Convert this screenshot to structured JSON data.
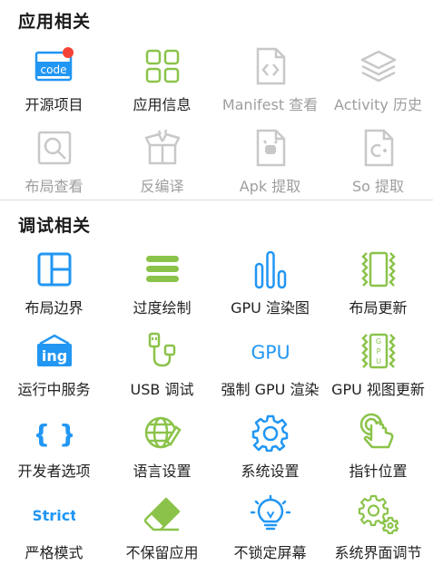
{
  "sections": {
    "app_related": {
      "title": "应用相关"
    },
    "debug_related": {
      "title": "调试相关"
    }
  },
  "app_items": [
    {
      "label": "开源项目",
      "icon": "code-icon",
      "enabled": true,
      "badge_text": "code"
    },
    {
      "label": "应用信息",
      "icon": "grid-apps-icon",
      "enabled": true
    },
    {
      "label": "Manifest 查看",
      "icon": "manifest-file-icon",
      "enabled": false
    },
    {
      "label": "Activity 历史",
      "icon": "layers-icon",
      "enabled": false
    },
    {
      "label": "布局查看",
      "icon": "layout-search-icon",
      "enabled": false
    },
    {
      "label": "反编译",
      "icon": "decompile-box-icon",
      "enabled": false
    },
    {
      "label": "Apk 提取",
      "icon": "apk-file-icon",
      "enabled": false
    },
    {
      "label": "So 提取",
      "icon": "so-file-icon",
      "enabled": false
    }
  ],
  "debug_items": [
    {
      "label": "布局边界",
      "icon": "layout-bounds-icon"
    },
    {
      "label": "过度绘制",
      "icon": "overdraw-icon"
    },
    {
      "label": "GPU 渲染图",
      "icon": "gpu-bars-icon"
    },
    {
      "label": "布局更新",
      "icon": "layout-update-icon"
    },
    {
      "label": "运行中服务",
      "icon": "running-services-icon",
      "badge_text": "ing"
    },
    {
      "label": "USB 调试",
      "icon": "usb-icon"
    },
    {
      "label": "强制 GPU 渲染",
      "icon": "gpu-text-icon",
      "badge_text": "GPU"
    },
    {
      "label": "GPU 视图更新",
      "icon": "gpu-view-update-icon",
      "badge_text": "GPU"
    },
    {
      "label": "开发者选项",
      "icon": "braces-icon",
      "badge_text": "{ }"
    },
    {
      "label": "语言设置",
      "icon": "language-globe-icon"
    },
    {
      "label": "系统设置",
      "icon": "settings-gear-icon"
    },
    {
      "label": "指针位置",
      "icon": "pointer-touch-icon"
    },
    {
      "label": "严格模式",
      "icon": "strict-icon",
      "badge_text": "Strict"
    },
    {
      "label": "不保留应用",
      "icon": "eraser-icon"
    },
    {
      "label": "不锁定屏幕",
      "icon": "lightbulb-icon"
    },
    {
      "label": "系统界面调节",
      "icon": "system-ui-gears-icon"
    }
  ],
  "colors": {
    "blue": "#2196f3",
    "green": "#8bc34a",
    "disabled": "#c8c8c8",
    "badge_red": "#f44336"
  }
}
